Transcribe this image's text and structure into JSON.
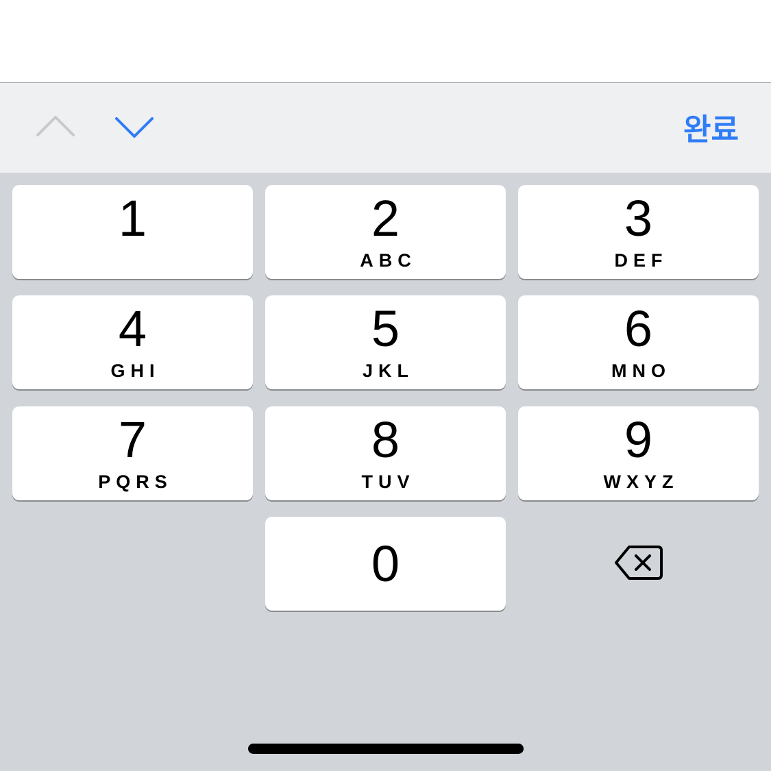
{
  "accessory": {
    "prev_icon": "chevron-up-icon",
    "next_icon": "chevron-down-icon",
    "done_label": "완료",
    "accent_color": "#2f7cf6",
    "disabled_color": "#c7c9cc"
  },
  "keys": [
    {
      "digit": "1",
      "letters": ""
    },
    {
      "digit": "2",
      "letters": "ABC"
    },
    {
      "digit": "3",
      "letters": "DEF"
    },
    {
      "digit": "4",
      "letters": "GHI"
    },
    {
      "digit": "5",
      "letters": "JKL"
    },
    {
      "digit": "6",
      "letters": "MNO"
    },
    {
      "digit": "7",
      "letters": "PQRS"
    },
    {
      "digit": "8",
      "letters": "TUV"
    },
    {
      "digit": "9",
      "letters": "WXYZ"
    },
    {
      "digit": "0",
      "letters": ""
    }
  ],
  "delete_icon": "backspace-icon"
}
